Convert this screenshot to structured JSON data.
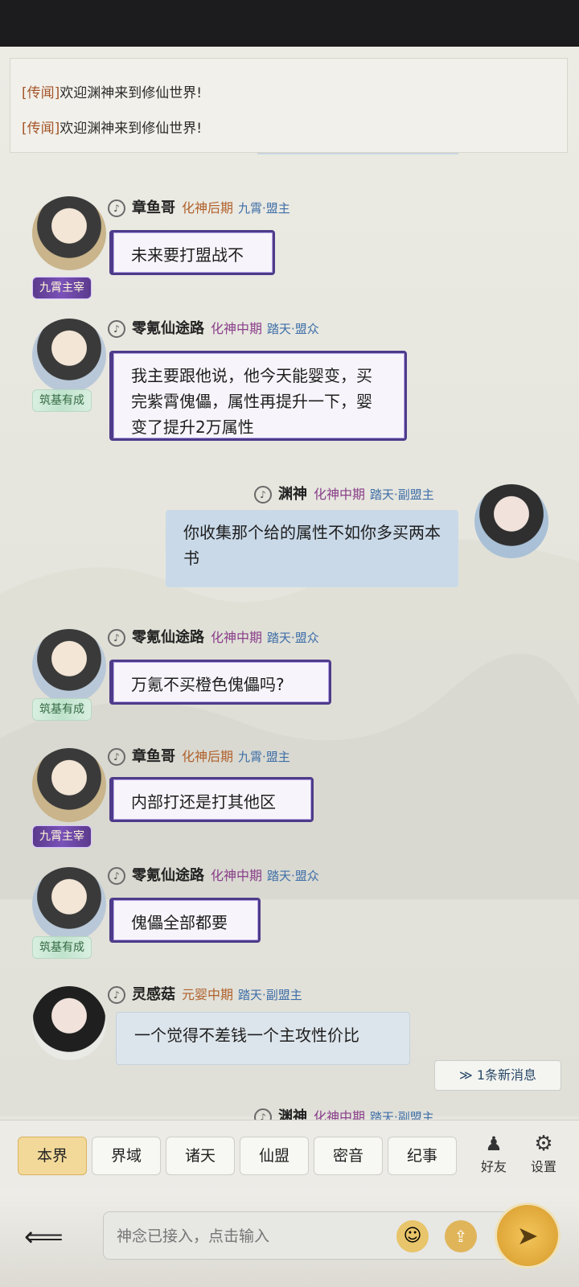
{
  "notices": [
    {
      "tag": "[传闻]",
      "text": "欢迎渊神来到修仙世界!"
    },
    {
      "tag": "[传闻]",
      "text": "欢迎渊神来到修仙世界!"
    }
  ],
  "messages": [
    {
      "side": "left",
      "name": "章鱼哥",
      "realm": "化神后期",
      "guild": "九霄·盟主",
      "badge": "九霄主宰",
      "badge_style": "purple",
      "text": "未来要打盟战不",
      "bubble": "purple"
    },
    {
      "side": "left",
      "name": "零氪仙途路",
      "realm": "化神中期",
      "guild": "踏天·盟众",
      "badge": "筑基有成",
      "badge_style": "green",
      "text": "我主要跟他说，他今天能婴变，买完紫霄傀儡，属性再提升一下，婴变了提升2万属性",
      "bubble": "purple"
    },
    {
      "side": "right",
      "name": "渊神",
      "realm": "化神中期",
      "guild": "踏天·副盟主",
      "text": "你收集那个给的属性不如你多买两本书",
      "bubble": "blue"
    },
    {
      "side": "left",
      "name": "零氪仙途路",
      "realm": "化神中期",
      "guild": "踏天·盟众",
      "badge": "筑基有成",
      "badge_style": "green",
      "text": "万氪不买橙色傀儡吗?",
      "bubble": "purple"
    },
    {
      "side": "left",
      "name": "章鱼哥",
      "realm": "化神后期",
      "guild": "九霄·盟主",
      "badge": "九霄主宰",
      "badge_style": "purple",
      "text": "内部打还是打其他区",
      "bubble": "purple"
    },
    {
      "side": "left",
      "name": "零氪仙途路",
      "realm": "化神中期",
      "guild": "踏天·盟众",
      "badge": "筑基有成",
      "badge_style": "green",
      "text": "傀儡全部都要",
      "bubble": "purple"
    },
    {
      "side": "left",
      "name": "灵感菇",
      "realm": "元婴中期",
      "guild": "踏天·副盟主",
      "text": "一个觉得不差钱一个主攻性价比",
      "bubble": "gray"
    },
    {
      "side": "right",
      "name": "渊神",
      "realm": "化神中期",
      "guild": "踏天·副盟主",
      "text": "",
      "bubble": "none"
    }
  ],
  "new_message": "1条新消息",
  "tabs": [
    "本界",
    "界域",
    "诸天",
    "仙盟",
    "密音",
    "纪事"
  ],
  "active_tab": "本界",
  "icons": {
    "friends": "好友",
    "settings": "设置"
  },
  "input": {
    "placeholder": "神念已接入，点击输入"
  },
  "colors": {
    "accent": "#f3d999",
    "bubble_border": "#4e3b8a",
    "self_bubble": "#c9d9e8"
  }
}
